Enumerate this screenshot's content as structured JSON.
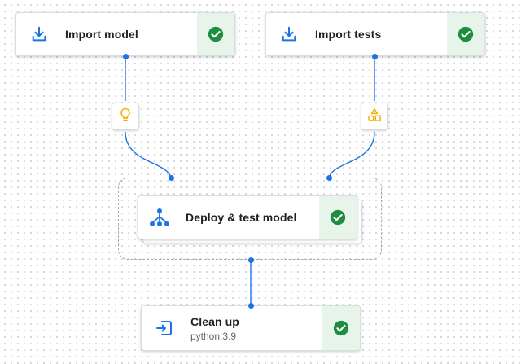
{
  "colors": {
    "accent": "#1a73e8",
    "success": "#1e8e3e",
    "success_bg": "#e6f4ea",
    "artifact_icon": "#f9ab00"
  },
  "nodes": {
    "import_model": {
      "label": "Import model",
      "icon": "download-icon",
      "status": "success-check-icon"
    },
    "import_tests": {
      "label": "Import tests",
      "icon": "download-icon",
      "status": "success-check-icon"
    },
    "deploy_test": {
      "label": "Deploy & test model",
      "icon": "pipeline-tree-icon",
      "status": "success-check-icon"
    },
    "clean_up": {
      "label": "Clean up",
      "sublabel": "python:3.9",
      "icon": "exit-icon",
      "status": "success-check-icon"
    }
  },
  "artifacts": {
    "model": {
      "icon": "lightbulb-icon"
    },
    "tests": {
      "icon": "shapes-icon"
    }
  }
}
